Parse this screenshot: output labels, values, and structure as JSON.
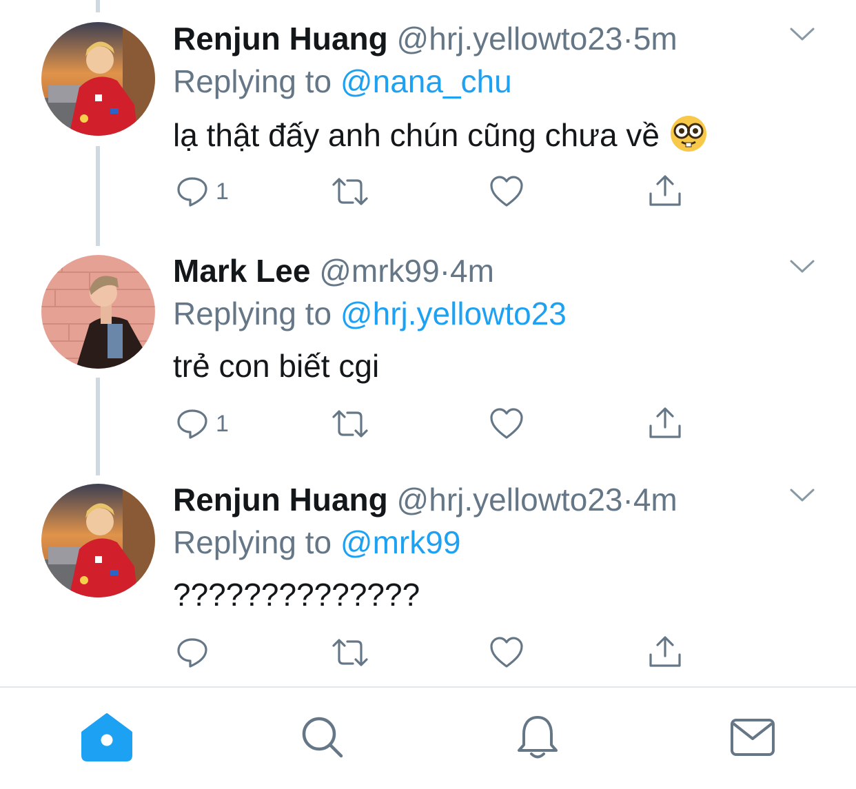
{
  "tweets": [
    {
      "name": "Renjun Huang",
      "handle": "@hrj.yellowto23",
      "separator": "·",
      "time": "5m",
      "replying_label": "Replying to",
      "replying_to": "@nana_chu",
      "text": "lạ thật đấy anh chún cũng chưa về",
      "emoji_icon": "nerd-face-emoji",
      "reply_count": "1"
    },
    {
      "name": "Mark Lee",
      "handle": "@mrk99",
      "separator": "·",
      "time": "4m",
      "replying_label": "Replying to",
      "replying_to": "@hrj.yellowto23",
      "text": "trẻ con biết cgi",
      "reply_count": "1"
    },
    {
      "name": "Renjun Huang",
      "handle": "@hrj.yellowto23",
      "separator": "·",
      "time": "4m",
      "replying_label": "Replying to",
      "replying_to": "@mrk99",
      "text": "??????????????",
      "reply_count": ""
    }
  ],
  "action_icons": [
    "reply-icon",
    "retweet-icon",
    "like-icon",
    "share-icon"
  ],
  "tabbar": {
    "items": [
      "home-icon",
      "search-icon",
      "notifications-icon",
      "messages-icon"
    ],
    "active": "home-icon"
  },
  "colors": {
    "accent": "#1da1f2",
    "text_primary": "#14171a",
    "text_secondary": "#657786",
    "thread_line": "#cfd9e1",
    "divider": "#e1e8ed"
  }
}
